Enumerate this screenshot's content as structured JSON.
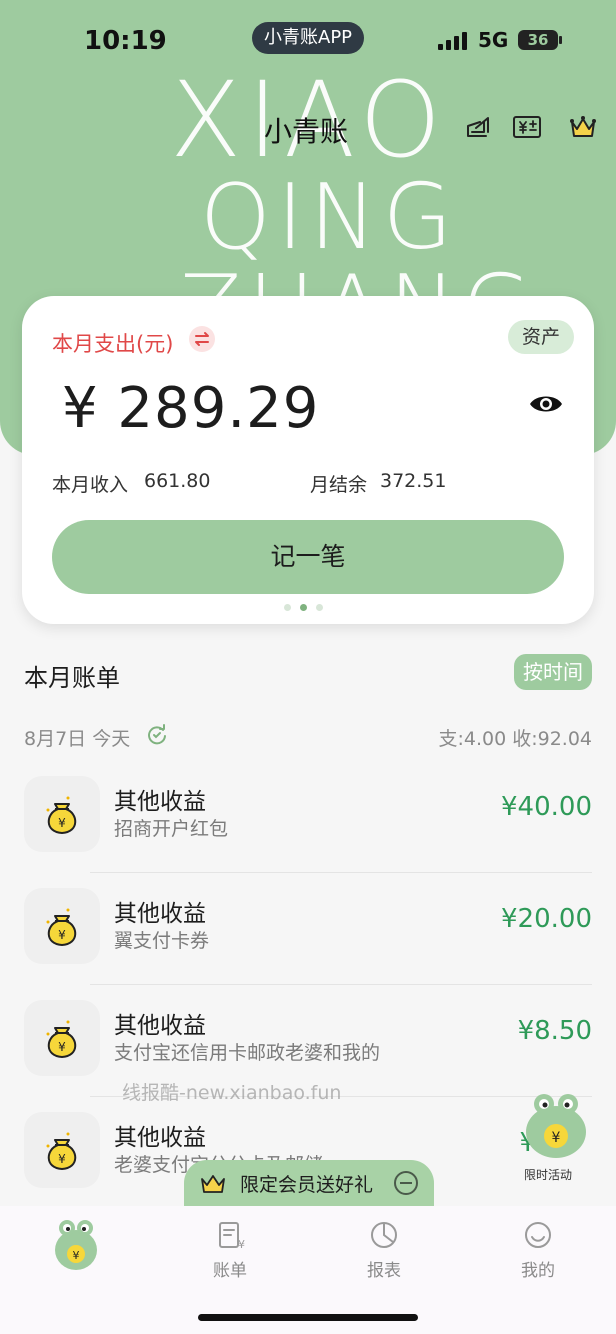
{
  "status_bar": {
    "time": "10:19",
    "app_name": "小青账APP",
    "network": "5G",
    "battery": "36"
  },
  "header": {
    "title": "小青账",
    "background_text": [
      "XIAO",
      "QING",
      "ZHANG"
    ]
  },
  "summary": {
    "expense_label": "本月支出(元)",
    "assets_label": "资产",
    "expense_amount": "¥ 289.29",
    "income_label": "本月收入",
    "income_value": "661.80",
    "balance_label": "月结余",
    "balance_value": "372.51",
    "record_button": "记一笔"
  },
  "bills": {
    "title": "本月账单",
    "sort_label": "按时间",
    "date_label": "8月7日 今天",
    "day_summary": "支:4.00 收:92.04",
    "items": [
      {
        "category": "其他收益",
        "note": "招商开户红包",
        "amount": "¥40.00"
      },
      {
        "category": "其他收益",
        "note": "翼支付卡券",
        "amount": "¥20.00"
      },
      {
        "category": "其他收益",
        "note": "支付宝还信用卡邮政老婆和我的",
        "amount": "¥8.50"
      },
      {
        "category": "其他收益",
        "note": "老婆支付宝分分卡及邮储",
        "amount": "¥"
      }
    ]
  },
  "watermark": "线报酷-new.xianbao.fun",
  "promo": {
    "text": "限定会员送好礼"
  },
  "floating_badge": {
    "label": "限时活动"
  },
  "tabbar": {
    "bills": "账单",
    "reports": "报表",
    "mine": "我的"
  },
  "colors": {
    "brand_green": "#9ecb9f",
    "income_green": "#2e9a58",
    "expense_red": "#e04848"
  }
}
